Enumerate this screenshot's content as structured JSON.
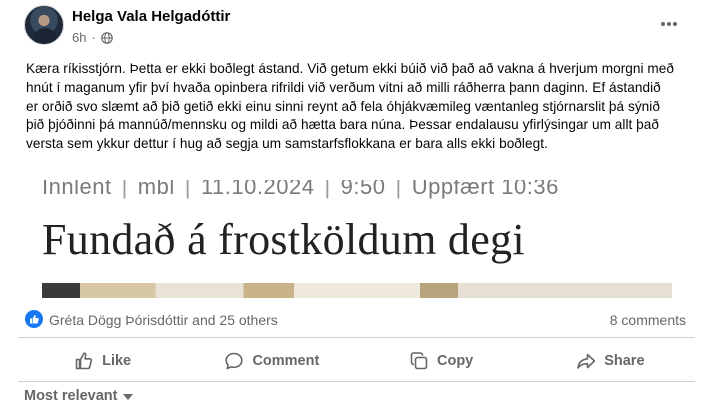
{
  "post": {
    "author": "Helga Vala Helgadóttir",
    "time": "6h",
    "separator": "·",
    "privacy_icon": "globe-icon",
    "text": "Kæra ríkisstjórn. Þetta er ekki boðlegt ástand. Við getum ekki búið við það að vakna á hverjum morgni með hnút í maganum yfir því hvaða opinbera rifrildi við verðum vitni að milli ráðherra þann daginn. Ef ástandið er orðið svo slæmt að þið getið ekki einu sinni reynt að fela óhjákvæmileg væntanleg stjórnarslit þá sýnið þið þjóðinni þá mannúð/mennsku og mildi að hætta bara núna. Þessar endalausu yfirlýsingar um allt það versta sem ykkur dettur í hug að segja um samstarfsflokkana er bara alls ekki boðlegt."
  },
  "article": {
    "category": "Innlent",
    "source": "mbl",
    "date": "11.10.2024",
    "time": "9:50",
    "updated": "Uppfært 10:36",
    "separator": "|",
    "title": "Fundað á frostköldum degi"
  },
  "reactions": {
    "text": "Gréta Dögg Þórisdóttir and 25 others",
    "comments": "8 comments",
    "like_color": "#1877f2"
  },
  "actions": {
    "like": "Like",
    "comment": "Comment",
    "copy": "Copy",
    "share": "Share"
  },
  "sort": {
    "label": "Most relevant"
  }
}
